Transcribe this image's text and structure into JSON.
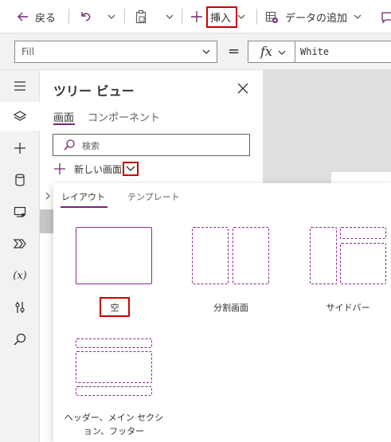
{
  "toolbar": {
    "back_label": "戻る",
    "insert_label": "挿入",
    "add_data_label": "データの追加"
  },
  "formula_bar": {
    "property": "Fill",
    "equals": "=",
    "fx": "fx",
    "value": "White"
  },
  "tree_view": {
    "title": "ツリー ビュー",
    "tabs": [
      "画面",
      "コンポーネント"
    ],
    "active_tab": 0,
    "search_placeholder": "検索",
    "new_screen_label": "新しい画面"
  },
  "new_screen_flyout": {
    "tabs": [
      "レイアウト",
      "テンプレート"
    ],
    "active_tab": 0,
    "layouts": [
      {
        "label": "空"
      },
      {
        "label": "分割画面"
      },
      {
        "label": "サイドバー"
      },
      {
        "label": "ヘッダー、メイン セクション、フッター"
      }
    ]
  },
  "colors": {
    "accent": "#742774",
    "highlight": "#d10000",
    "layout_stroke": "#8b2a8f"
  }
}
